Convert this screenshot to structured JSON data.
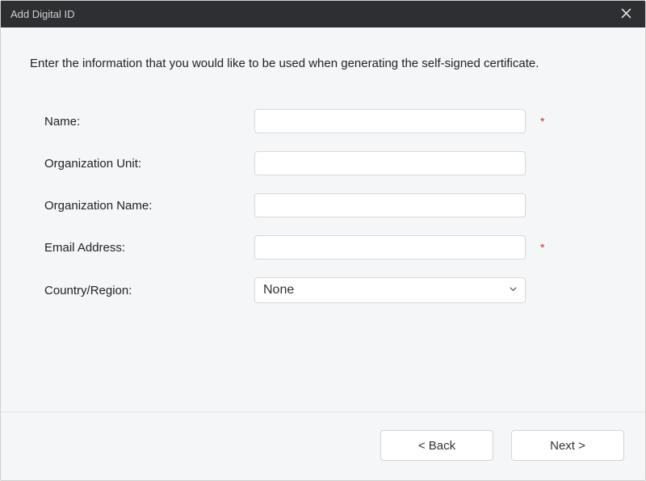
{
  "titlebar": {
    "title": "Add Digital ID"
  },
  "intro": "Enter the information that you would like to be used when generating the self-signed certificate.",
  "form": {
    "name": {
      "label": "Name:",
      "value": "",
      "required_marker": "*"
    },
    "org_unit": {
      "label": "Organization Unit:",
      "value": ""
    },
    "org_name": {
      "label": "Organization Name:",
      "value": ""
    },
    "email": {
      "label": "Email Address:",
      "value": "",
      "required_marker": "*"
    },
    "country": {
      "label": "Country/Region:",
      "selected": "None"
    }
  },
  "footer": {
    "back_label": "< Back",
    "next_label": "Next >"
  }
}
